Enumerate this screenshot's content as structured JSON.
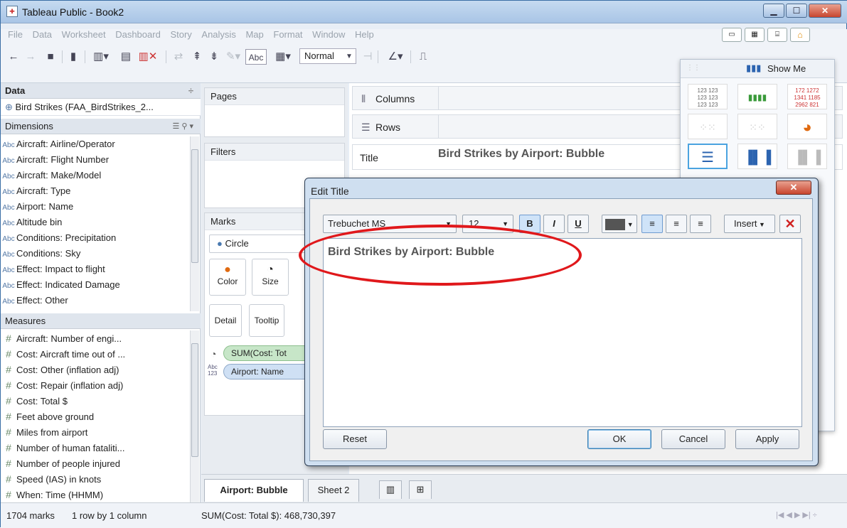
{
  "window": {
    "title": "Tableau Public - Book2"
  },
  "menu": [
    "File",
    "Data",
    "Worksheet",
    "Dashboard",
    "Story",
    "Analysis",
    "Map",
    "Format",
    "Window",
    "Help"
  ],
  "toolbar": {
    "abc_label": "Abc",
    "fit_value": "Normal"
  },
  "data_pane": {
    "header": "Data",
    "datasource": "Bird Strikes (FAA_BirdStrikes_2...",
    "dimensions_header": "Dimensions",
    "dimension_prefix": "Abc",
    "dimensions": [
      "Aircraft: Airline/Operator",
      "Aircraft: Flight Number",
      "Aircraft: Make/Model",
      "Aircraft: Type",
      "Airport: Name",
      "Altitude bin",
      "Conditions: Precipitation",
      "Conditions: Sky",
      "Effect: Impact to flight",
      "Effect: Indicated Damage",
      "Effect: Other"
    ],
    "measures_header": "Measures",
    "measure_prefix": "#",
    "measures": [
      "Aircraft: Number of engi...",
      "Cost: Aircraft time out of ...",
      "Cost: Other (inflation adj)",
      "Cost: Repair (inflation adj)",
      "Cost: Total $",
      "Feet above ground",
      "Miles from airport",
      "Number of human fataliti...",
      "Number of people injured",
      "Speed (IAS) in knots",
      "When: Time (HHMM)"
    ]
  },
  "cards": {
    "pages": "Pages",
    "filters": "Filters",
    "marks": "Marks",
    "mark_type": "Circle",
    "color": "Color",
    "size": "Size",
    "detail": "Detail",
    "tooltip": "Tooltip",
    "pill_size": "SUM(Cost: Tot",
    "pill_label_icon": "Abc 123",
    "pill_label": "Airport: Name"
  },
  "shelves": {
    "columns": "Columns",
    "rows": "Rows",
    "title_label": "Title",
    "title_text": "Bird Strikes by Airport: Bubble"
  },
  "show_me": {
    "label": "Show Me",
    "text_table": "123 123",
    "crosstab_nums": [
      "172",
      "1272",
      "1341",
      "1185",
      "2962",
      "821"
    ]
  },
  "tabs": [
    "Airport: Bubble",
    "Sheet 2"
  ],
  "status": {
    "marks": "1704 marks",
    "dims": "1 row by 1 column",
    "sum": "SUM(Cost: Total $): 468,730,397"
  },
  "dialog": {
    "title": "Edit Title",
    "font": "Trebuchet MS",
    "size": "12",
    "bold": "B",
    "italic": "I",
    "underline": "U",
    "insert": "Insert",
    "text": "Bird Strikes by Airport: Bubble",
    "reset": "Reset",
    "ok": "OK",
    "cancel": "Cancel",
    "apply": "Apply"
  },
  "colors": {
    "accent": "#3a6ea5",
    "highlight": "#e0181b"
  }
}
